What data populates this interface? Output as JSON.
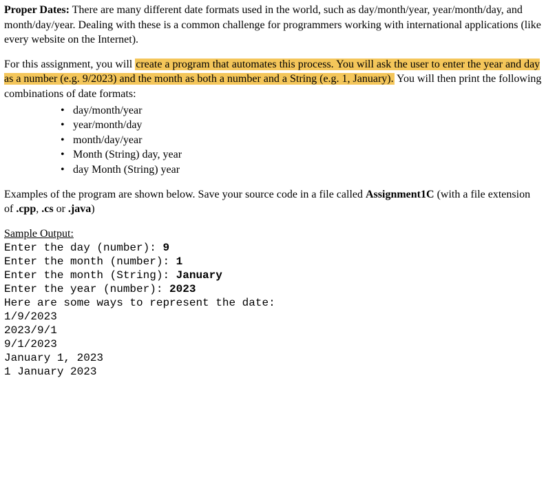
{
  "p1": {
    "lead": "Proper Dates:",
    "body": " There are many different date formats used in the world, such as day/month/year, year/month/day, and month/day/year. Dealing with these is a common challenge for programmers working with international applications (like every website on the Internet)."
  },
  "p2": {
    "pre": "For this assignment, you will ",
    "hl": "create a program that automates this process. You will ask the user to enter the year and day as a number (e.g. 9/2023) and the month as both a number and a String (e.g. 1, January).",
    "post": " You will then print the following combinations of date formats:"
  },
  "formats": [
    "day/month/year",
    "year/month/day",
    "month/day/year",
    "Month (String) day, year",
    "day Month (String) year"
  ],
  "p3": {
    "a": "Examples of the program are shown below. Save your source code in a file called ",
    "b": "Assignment1C",
    "c": " (with a file extension of ",
    "d": ".cpp",
    "e": ", ",
    "f": ".cs",
    "g": " or ",
    "h": ".java",
    "i": ")"
  },
  "sample_label": "Sample Output: ",
  "sample": {
    "l1p": "Enter the day (number): ",
    "l1v": "9",
    "l2p": "Enter the month (number): ",
    "l2v": "1",
    "l3p": "Enter the month (String): ",
    "l3v": "January",
    "l4p": "Enter the year (number): ",
    "l4v": "2023",
    "l5": "Here are some ways to represent the date:",
    "l6": "1/9/2023",
    "l7": "2023/9/1",
    "l8": "9/1/2023",
    "l9": "January 1, 2023",
    "l10": "1 January 2023"
  }
}
